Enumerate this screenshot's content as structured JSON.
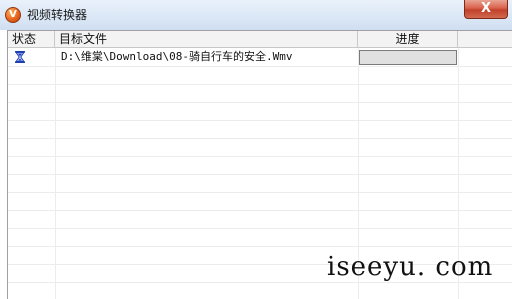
{
  "window": {
    "title": "视频转换器",
    "close_label": "X",
    "app_icon_letter": "V"
  },
  "list": {
    "columns": [
      "状态",
      "目标文件",
      "进度"
    ],
    "rows": [
      {
        "status_icon": "hourglass-icon",
        "file": "D:\\维棠\\Download\\08-骑自行车的安全.Wmv",
        "progress": 0
      }
    ]
  },
  "watermark": "iseeyu. com",
  "colors": {
    "close_button": "#c9442d",
    "progress_border": "#7a7a7a",
    "hourglass": "#1f3fb5"
  }
}
